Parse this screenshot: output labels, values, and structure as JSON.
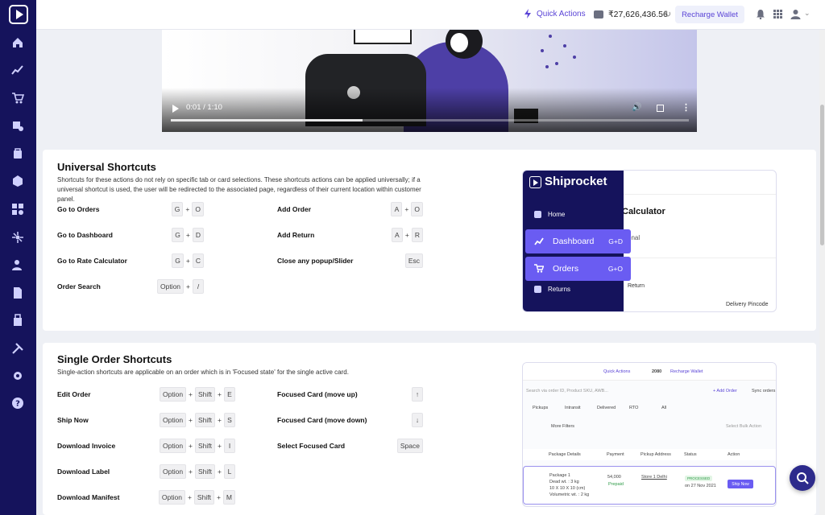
{
  "topbar": {
    "quick_actions": "Quick Actions",
    "balance": "₹27,626,436.56",
    "recharge": "Recharge Wallet"
  },
  "video": {
    "time": "0:01 / 1:10",
    "progress": 0.37
  },
  "universal": {
    "title": "Universal Shortcuts",
    "desc": "Shortcuts for these actions do not rely on specific tab or card selections. These shortcuts actions can be applied universally; if a universal shortcut is used, the user will be redirected to the associated page, regardless of their current location within customer panel.",
    "left": [
      {
        "label": "Go to Orders",
        "keys": [
          "G",
          "O"
        ]
      },
      {
        "label": "Go to Dashboard",
        "keys": [
          "G",
          "D"
        ]
      },
      {
        "label": "Go to Rate Calculator",
        "keys": [
          "G",
          "C"
        ]
      },
      {
        "label": "Order Search",
        "keys": [
          "Option",
          "/"
        ]
      }
    ],
    "right": [
      {
        "label": "Add Order",
        "keys": [
          "A",
          "O"
        ]
      },
      {
        "label": "Add Return",
        "keys": [
          "A",
          "R"
        ]
      },
      {
        "label": "Close any popup/Slider",
        "keys": [
          "Esc"
        ]
      }
    ],
    "preview": {
      "brand": "Shiprocket",
      "home": "Home",
      "dashboard": "Dashboard",
      "dashboard_key": "G+D",
      "orders": "Orders",
      "orders_key": "G+O",
      "returns": "Returns",
      "rate_calc": "Calculator",
      "optional": "onal",
      "return_text": "Return",
      "pincode": "Delivery Pincode"
    }
  },
  "single": {
    "title": "Single Order Shortcuts",
    "desc": "Single-action shortcuts are applicable on an order which is in 'Focused state' for the single active card.",
    "left": [
      {
        "label": "Edit Order",
        "keys": [
          "Option",
          "Shift",
          "E"
        ]
      },
      {
        "label": "Ship Now",
        "keys": [
          "Option",
          "Shift",
          "S"
        ]
      },
      {
        "label": "Download Invoice",
        "keys": [
          "Option",
          "Shift",
          "I"
        ]
      },
      {
        "label": "Download Label",
        "keys": [
          "Option",
          "Shift",
          "L"
        ]
      },
      {
        "label": "Download Manifest",
        "keys": [
          "Option",
          "Shift",
          "M"
        ]
      }
    ],
    "right": [
      {
        "label": "Focused Card (move up)",
        "keys": [
          "↑"
        ]
      },
      {
        "label": "Focused Card (move down)",
        "keys": [
          "↓"
        ]
      },
      {
        "label": "Select Focused Card",
        "keys": [
          "Space"
        ]
      }
    ],
    "preview": {
      "quick_actions": "Quick Actions",
      "balance": "2080",
      "recharge": "Recharge Wallet",
      "search": "Search via order ID, Product SKU, AWB...",
      "add_order": "+ Add Order",
      "sync": "Sync orders",
      "tabs": [
        "Pickups",
        "Intransit",
        "Delivered",
        "RTO",
        "All"
      ],
      "more_filters": "More Filters",
      "bulk": "Select Bulk Action",
      "cols": [
        "Package Details",
        "Payment",
        "Pickup Address",
        "Status",
        "Action"
      ],
      "pkg": "Package 1",
      "dead_wt": "Dead wt. : 3 kg",
      "dims": "10 X 10 X 10 (cm)",
      "vol_wt": "Volumetric wt. : 2 kg",
      "amount": "54,000",
      "pay_status": "Prepaid",
      "pickup": "Store 1 Delhi",
      "status": "PROCESSED",
      "date": "on 27 Nov 2021",
      "ship_now": "Ship Now"
    }
  }
}
